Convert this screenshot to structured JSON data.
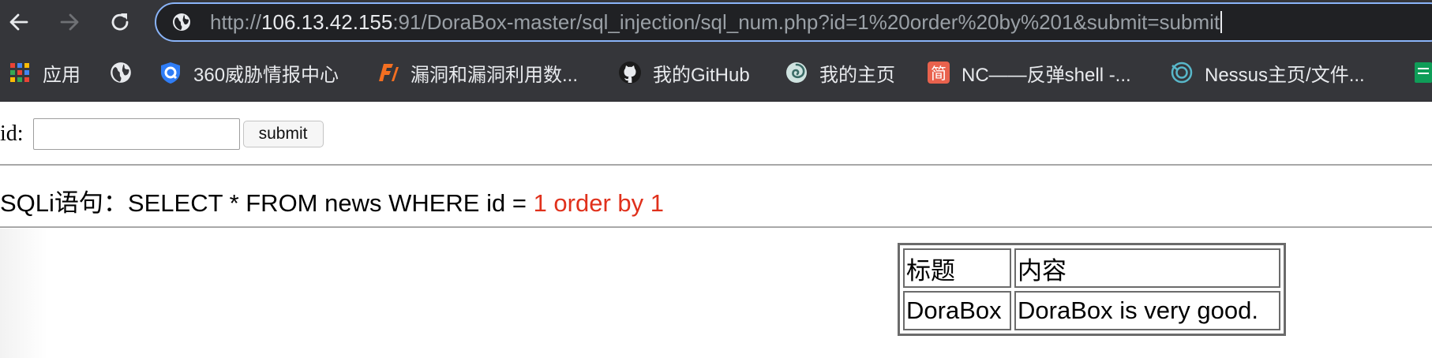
{
  "browser": {
    "url_prefix": "http://",
    "url_host": "106.13.42.155",
    "url_rest": ":91/DoraBox-master/sql_injection/sql_num.php?id=1%20order%20by%201&submit=submit"
  },
  "bookmarks": [
    {
      "label": "应用",
      "icon": "apps-grid-icon"
    },
    {
      "label": "",
      "icon": "globe-icon"
    },
    {
      "label": "360威胁情报中心",
      "icon": "360-shield-icon"
    },
    {
      "label": "漏洞和漏洞利用数...",
      "icon": "exploit-db-icon"
    },
    {
      "label": "我的GitHub",
      "icon": "github-icon"
    },
    {
      "label": "我的主页",
      "icon": "swirl-icon"
    },
    {
      "label": "NC——反弹shell -...",
      "icon": "jianshu-icon"
    },
    {
      "label": "Nessus主页/文件...",
      "icon": "nessus-icon"
    }
  ],
  "form": {
    "id_label": "id:",
    "id_value": "",
    "submit_label": "submit"
  },
  "sql": {
    "prefix": "SQLi语句：SELECT * FROM news WHERE id = ",
    "injected": "1 order by 1"
  },
  "table": {
    "headers": [
      "标题",
      "内容"
    ],
    "rows": [
      [
        "DoraBox",
        "DoraBox is very good."
      ]
    ]
  },
  "colors": {
    "injected_text": "#e0311c",
    "chrome_bg": "#35363a",
    "omnibox_focus": "#8ab4f8"
  }
}
